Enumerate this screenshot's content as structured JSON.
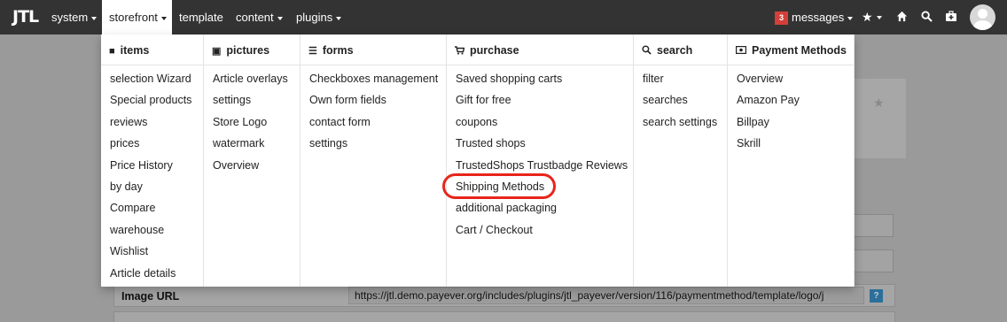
{
  "navbar": {
    "logo": "JTL",
    "menus": [
      {
        "label": "system",
        "active": false
      },
      {
        "label": "storefront",
        "active": true
      },
      {
        "label": "template",
        "active": false
      },
      {
        "label": "content",
        "active": false
      },
      {
        "label": "plugins",
        "active": false
      }
    ],
    "messages_count": "3",
    "messages_label": "messages"
  },
  "dropdown": {
    "columns": [
      {
        "title": "items",
        "icon": "box-icon",
        "items": [
          "selection Wizard",
          "Special products",
          "reviews",
          "prices",
          "Price History",
          "by day",
          "Compare",
          "warehouse",
          "Wishlist",
          "Article details"
        ]
      },
      {
        "title": "pictures",
        "icon": "image-icon",
        "items": [
          "Article overlays",
          "settings",
          "Store Logo",
          "watermark",
          "Overview"
        ]
      },
      {
        "title": "forms",
        "icon": "list-icon",
        "items": [
          "Checkboxes management",
          "Own form fields",
          "contact form",
          "settings"
        ]
      },
      {
        "title": "purchase",
        "icon": "cart-icon",
        "items": [
          "Saved shopping carts",
          "Gift for free",
          "coupons",
          "Trusted shops",
          "TrustedShops Trustbadge Reviews",
          "Shipping Methods",
          "additional packaging",
          "Cart / Checkout"
        ]
      },
      {
        "title": "search",
        "icon": "search-icon",
        "items": [
          "filter",
          "searches",
          "search settings"
        ]
      },
      {
        "title": "Payment Methods",
        "icon": "money-icon",
        "items": [
          "Overview",
          "Amazon Pay",
          "Billpay",
          "Skrill"
        ]
      }
    ]
  },
  "background": {
    "image_url_label": "Image URL",
    "image_url_value": "https://jtl.demo.payever.org/includes/plugins/jtl_payever/version/116/paymentmethod/template/logo/j",
    "help_glyph": "?"
  },
  "colors": {
    "navbar": "#333333",
    "highlight": "#e8251b",
    "badge": "#d43f3a"
  }
}
